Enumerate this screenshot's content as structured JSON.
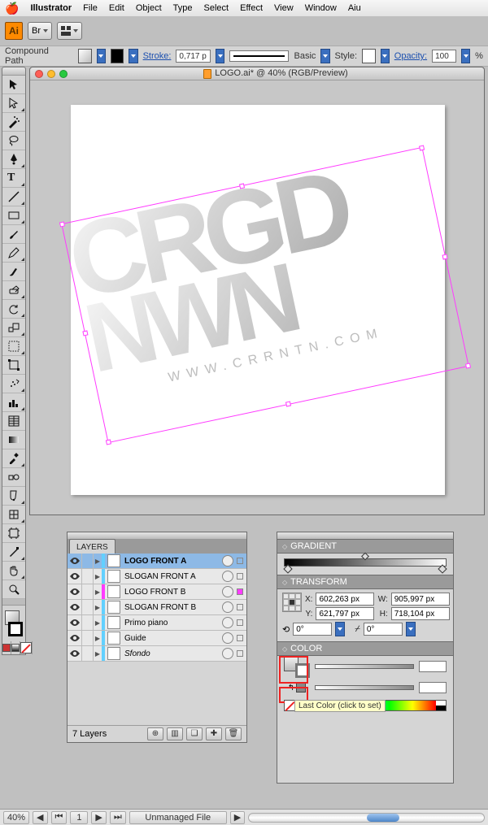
{
  "menubar": {
    "app": "Illustrator",
    "items": [
      "File",
      "Edit",
      "Object",
      "Type",
      "Select",
      "Effect",
      "View",
      "Window",
      "Aiu"
    ]
  },
  "apptoolbar": {
    "app_initials": "Ai",
    "bridge": "Br"
  },
  "controlbar": {
    "context": "Compound Path",
    "stroke_label": "Stroke:",
    "stroke_weight": "0,717 p",
    "brush_name": "Basic",
    "style_label": "Style:",
    "opacity_label": "Opacity:",
    "opacity_value": "100",
    "opacity_unit": "%"
  },
  "document": {
    "title": "LOGO.ai* @ 40% (RGB/Preview)"
  },
  "artwork": {
    "line1": "CRGD",
    "line2": "NWN",
    "url": "WWW.CRRNTN.COM"
  },
  "layers_panel": {
    "title": "LAYERS",
    "layers": [
      {
        "name": "LOGO FRONT A",
        "color": "#62d0ff",
        "bold": true,
        "selected": true,
        "selcolor": null
      },
      {
        "name": "SLOGAN FRONT A",
        "color": "#62d0ff"
      },
      {
        "name": "LOGO FRONT B",
        "color": "#ff3bff",
        "selcolor": "#ff3bff"
      },
      {
        "name": "SLOGAN FRONT B",
        "color": "#62d0ff"
      },
      {
        "name": "Primo piano",
        "color": "#62d0ff"
      },
      {
        "name": "Guide",
        "color": "#62d0ff"
      },
      {
        "name": "Sfondo",
        "color": "#62d0ff",
        "italic": true
      }
    ],
    "footer": "7 Layers"
  },
  "gradient_panel": {
    "title": "GRADIENT"
  },
  "transform_panel": {
    "title": "TRANSFORM",
    "x_label": "X:",
    "x": "602,263 px",
    "y_label": "Y:",
    "y": "621,797 px",
    "w_label": "W:",
    "w": "905,997 px",
    "h_label": "H:",
    "h": "718,104 px",
    "angle": "0°",
    "shear": "0°"
  },
  "color_panel": {
    "title": "COLOR",
    "tooltip": "Last Color (click to set)"
  },
  "statusbar": {
    "zoom": "40%",
    "page": "1",
    "doc_state": "Unmanaged File"
  }
}
